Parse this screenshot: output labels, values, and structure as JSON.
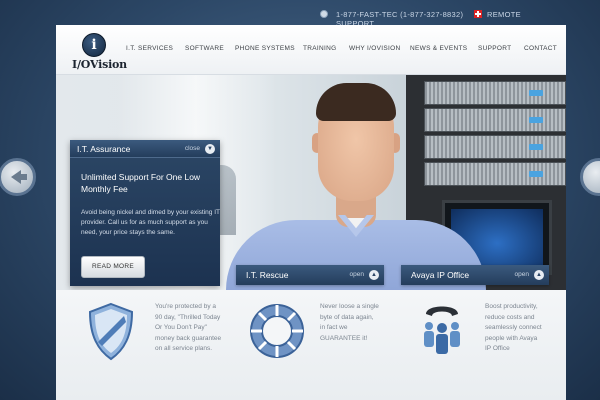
{
  "topbar": {
    "phone": "1-877-FAST-TEC (1-877-327-8832)",
    "support": "SUPPORT",
    "remote": "REMOTE"
  },
  "logo": {
    "mark": "i",
    "text": "I/OVision"
  },
  "nav": [
    {
      "label": "I.T. SERVICES"
    },
    {
      "label": "SOFTWARE"
    },
    {
      "label": "PHONE SYSTEMS"
    },
    {
      "label": "TRAINING"
    },
    {
      "label": "WHY I/OVISION"
    },
    {
      "label": "NEWS & EVENTS"
    },
    {
      "label": "SUPPORT"
    },
    {
      "label": "CONTACT"
    }
  ],
  "assurance": {
    "title": "I.T. Assurance",
    "state": "close",
    "lead": "Unlimited Support For One Low Monthly Fee",
    "body": "Avoid being nickel and dimed by your existing IT provider. Call us for as much support as you need, your price stays the same.",
    "button": "READ MORE"
  },
  "features": [
    {
      "title": "",
      "state": "",
      "icon": "shield-icon",
      "desc": "You're protected by a 90 day, \"Thrilled Today Or You Don't Pay\" money back guarantee on all service plans."
    },
    {
      "title": "I.T. Rescue",
      "state": "open",
      "icon": "life-ring-icon",
      "desc": "Never loose a single byte of data again, in fact we GUARANTEE it!"
    },
    {
      "title": "Avaya IP Office",
      "state": "open",
      "icon": "team-phone-icon",
      "desc": "Boost productivity, reduce costs and seamlessly connect people with Avaya IP Office"
    }
  ],
  "colors": {
    "brand": "#2c4766",
    "accent": "#4aa3e0"
  }
}
